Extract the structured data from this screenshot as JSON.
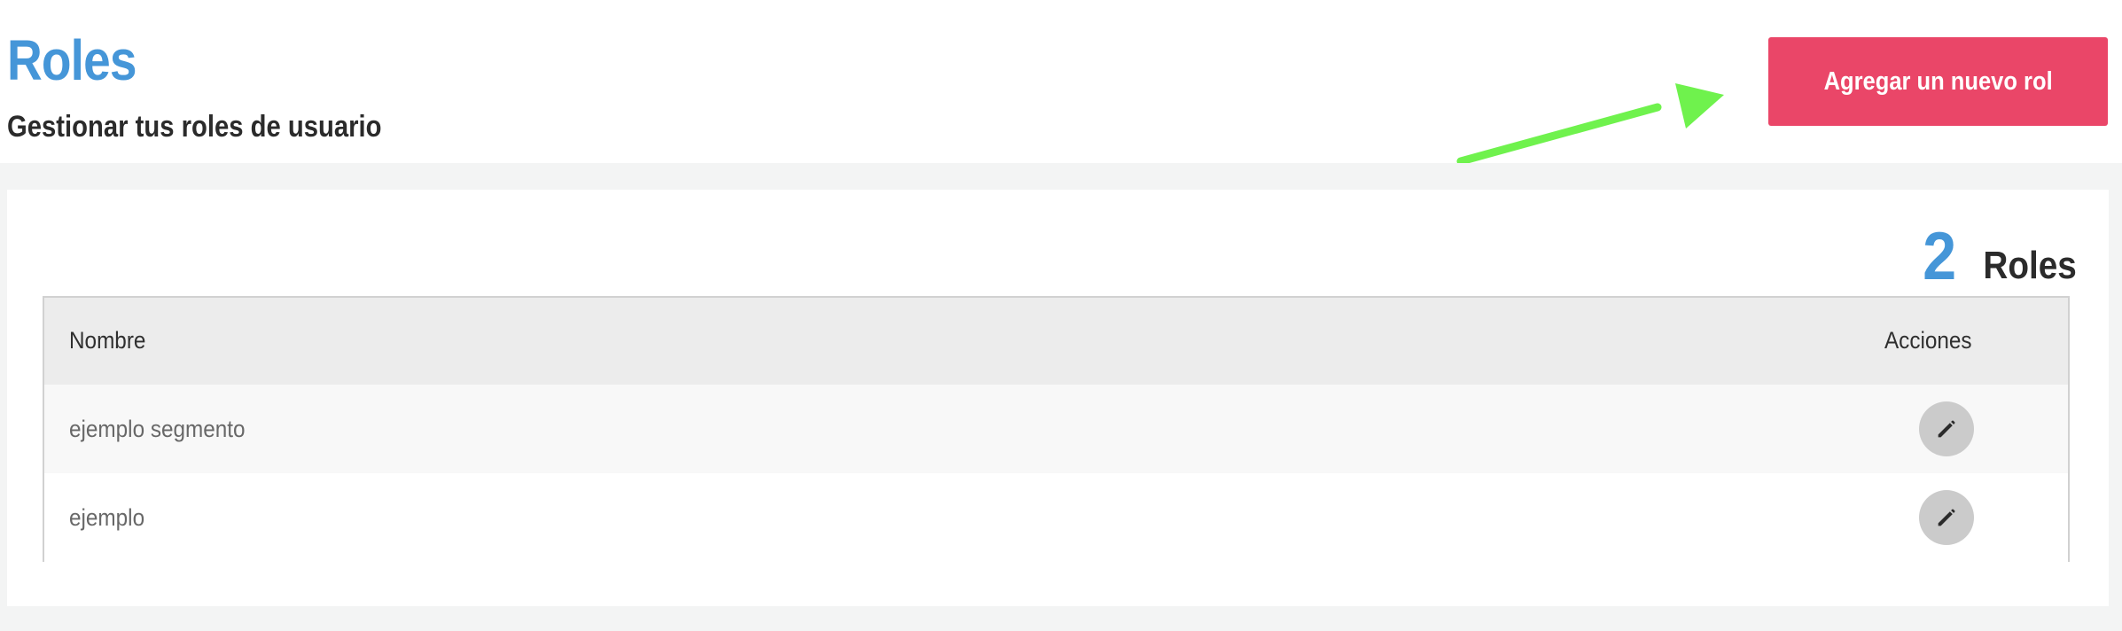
{
  "header": {
    "title": "Roles",
    "subtitle": "Gestionar tus roles de usuario",
    "add_button_label": "Agregar un nuevo rol"
  },
  "summary": {
    "count": "2",
    "label": "Roles"
  },
  "table": {
    "columns": [
      "Nombre",
      "Acciones"
    ],
    "rows": [
      {
        "name": "ejemplo segmento",
        "action_icon": "pencil-icon"
      },
      {
        "name": "ejemplo",
        "action_icon": "pencil-icon"
      }
    ]
  },
  "colors": {
    "title_blue": "#4596d8",
    "button_pink": "#ea4668",
    "arrow_green": "#6ff24d",
    "edit_gray": "#cbcbcb"
  }
}
